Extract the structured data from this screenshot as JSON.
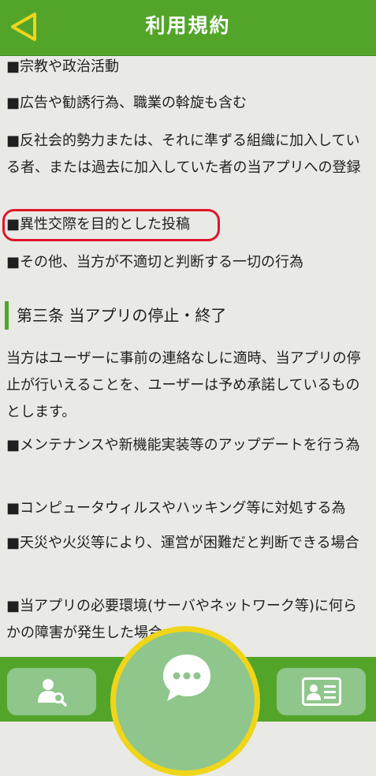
{
  "header": {
    "title": "利用規約",
    "back_icon": "back-triangle-icon"
  },
  "content": {
    "items": [
      "■宗教や政治活動",
      "■広告や勧誘行為、職業の斡旋も含む",
      "■反社会的勢力または、それに準ずる組織に加入している者、または過去に加入していた者の当アプリへの登録",
      "■異性交際を目的とした投稿",
      "■その他、当方が不適切と判断する一切の行為"
    ],
    "section_heading": "第三条 当アプリの停止・終了",
    "section_paragraph": "当方はユーザーに事前の連絡なしに適時、当アプリの停止が行いえることを、ユーザーは予め承諾しているものとします。",
    "section_items": [
      "■メンテナンスや新機能実装等のアップデートを行う為",
      "■コンピュータウィルスやハッキング等に対処する為",
      "■天災や火災等により、運営が困難だと判断できる場合",
      "■当アプリの必要環境(サーバやネットワーク等)に何らかの障害が発生した場合"
    ]
  },
  "footer": {
    "left_icon": "user-search-icon",
    "center_icon": "chat-bubble-icon",
    "right_icon": "id-card-icon"
  },
  "colors": {
    "header_green": "#53a52a",
    "button_green": "#8fc68b",
    "accent_yellow": "#f0d51a",
    "highlight_red": "#e0142a",
    "background": "#e9eae5"
  }
}
